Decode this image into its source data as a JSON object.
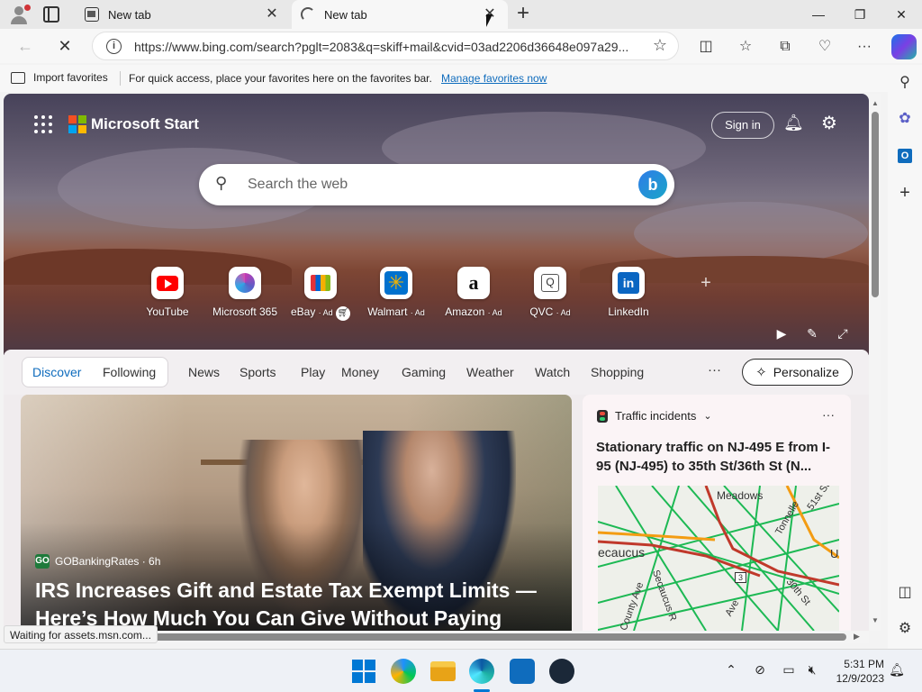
{
  "browser": {
    "tabs": [
      {
        "label": "New tab"
      },
      {
        "label": "New tab"
      }
    ],
    "address": "https://www.bing.com/search?pglt=2083&q=skiff+mail&cvid=03ad2206d36648e097a29...",
    "favorites_bar": {
      "import_label": "Import favorites",
      "message": "For quick access, place your favorites here on the favorites bar.",
      "manage_link": "Manage favorites now"
    },
    "status_text": "Waiting for assets.msn.com..."
  },
  "start": {
    "brand": "Microsoft Start",
    "signin_label": "Sign in",
    "search_placeholder": "Search the web",
    "tiles": [
      {
        "label": "YouTube",
        "ad": "",
        "icon": "youtube-icon"
      },
      {
        "label": "Microsoft 365",
        "ad": "",
        "icon": "microsoft-365-icon"
      },
      {
        "label": "eBay",
        "ad": "· Ad",
        "icon": "ebay-icon"
      },
      {
        "label": "Walmart",
        "ad": "· Ad",
        "icon": "walmart-icon"
      },
      {
        "label": "Amazon",
        "ad": "· Ad",
        "icon": "amazon-icon"
      },
      {
        "label": "QVC",
        "ad": "· Ad",
        "icon": "qvc-icon"
      },
      {
        "label": "LinkedIn",
        "ad": "",
        "icon": "linkedin-icon"
      }
    ],
    "feed_tabs": [
      "Discover",
      "Following",
      "News",
      "Sports",
      "Play",
      "Money",
      "Gaming",
      "Weather",
      "Watch",
      "Shopping"
    ],
    "more_label": "···",
    "personalize_label": "Personalize",
    "main_card": {
      "source": "GOBankingRates · 6h",
      "source_badge": "GO",
      "headline": "IRS Increases Gift and Estate Tax Exempt Limits — Here’s How Much You Can Give Without Paying"
    },
    "traffic_card": {
      "title": "Traffic incidents",
      "text": "Stationary traffic on NJ-495 E from I-95 (NJ-495) to 35th St/36th St (N...",
      "map_labels": [
        "Meadows",
        "ecaucus",
        "County Ave",
        "Secaucus R",
        "Ave",
        "3",
        "30th St",
        "Tonnelle",
        "51st St",
        "U"
      ]
    }
  },
  "taskbar": {
    "time": "5:31 PM",
    "date": "12/9/2023"
  },
  "colors": {
    "accent": "#0f6cbd",
    "hero_top": "#47425a",
    "hero_mesa": "#6d3828"
  }
}
